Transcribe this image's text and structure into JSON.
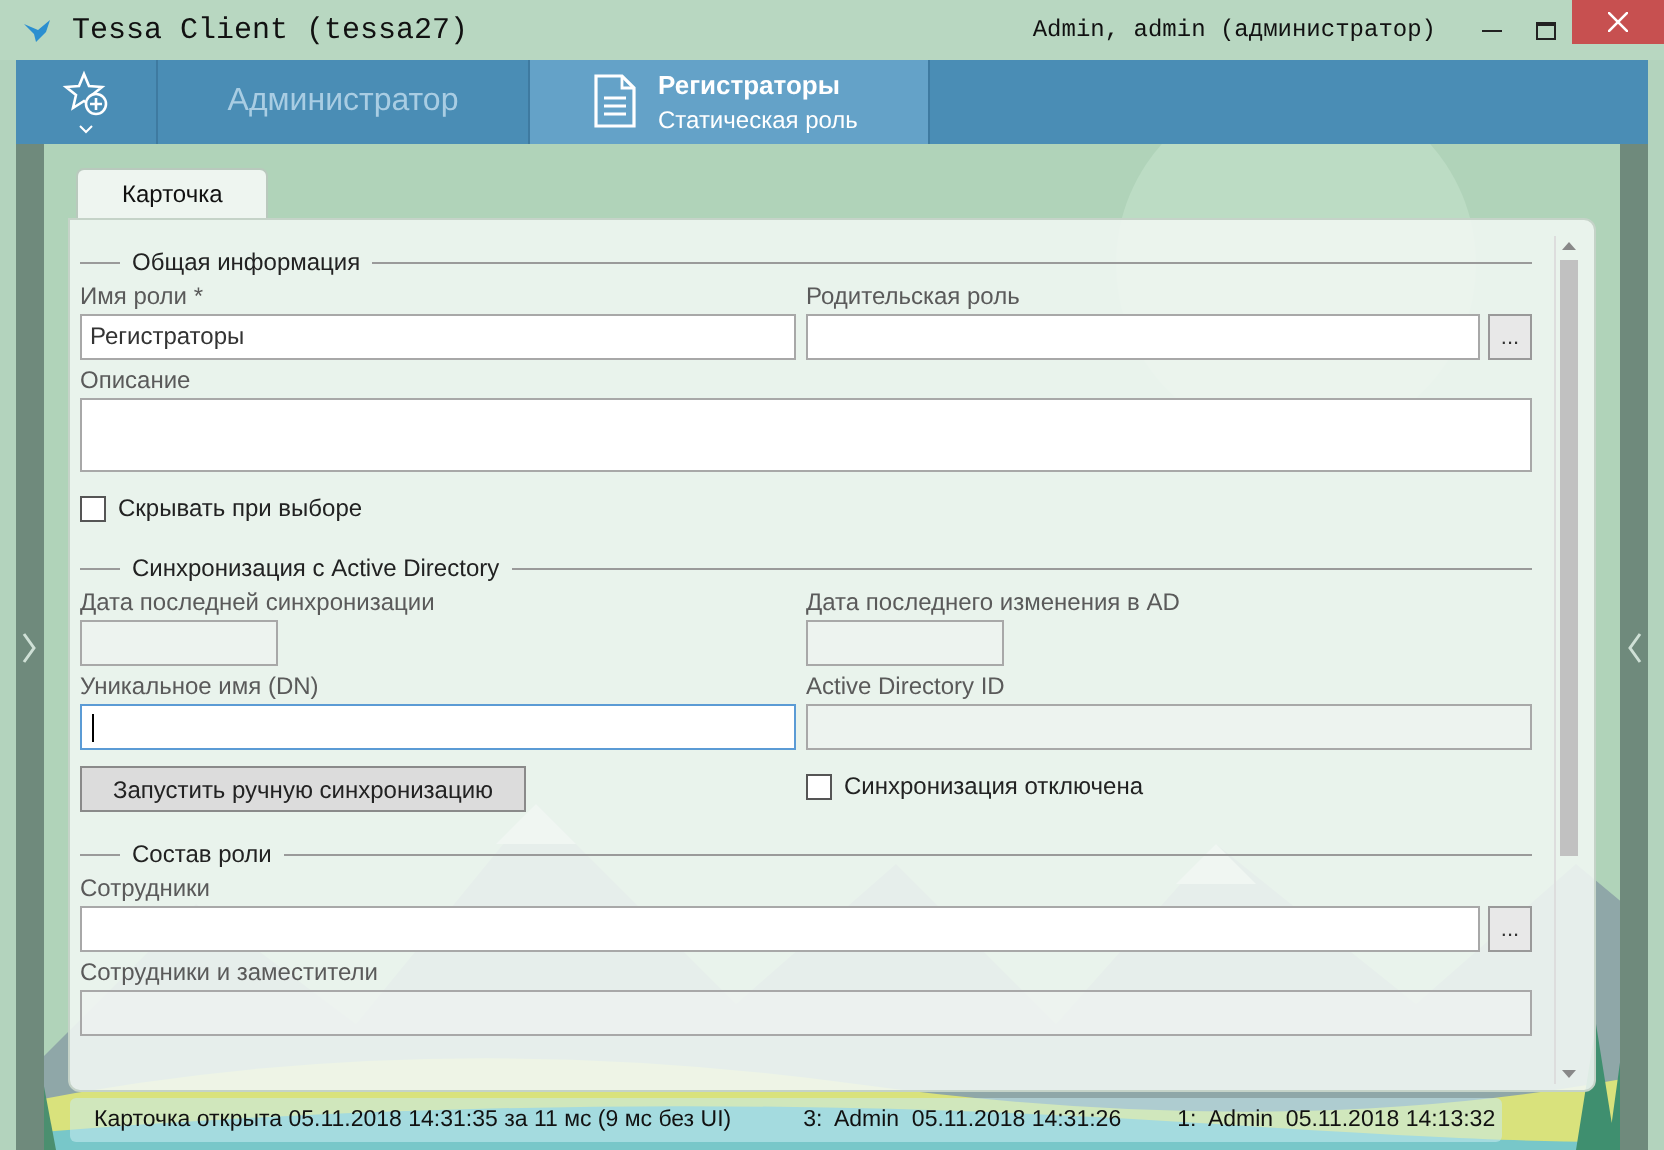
{
  "window": {
    "title": "Tessa Client (tessa27)",
    "user": "Admin, admin (администратор)"
  },
  "tabs": [
    {
      "title": "Администратор",
      "selected": false
    },
    {
      "title": "Регистраторы",
      "subtitle": "Статическая роль",
      "selected": true
    }
  ],
  "card_tabs": [
    {
      "label": "Карточка",
      "selected": true
    }
  ],
  "sections": [
    {
      "title": "Общая информация",
      "fields": [
        {
          "kind": "text",
          "label": "Имя роли  *",
          "value": "Регистраторы",
          "disabled": false,
          "focused": false
        },
        {
          "kind": "lookup",
          "label": "Родительская роль",
          "button": "...",
          "disabled": false
        },
        {
          "kind": "textarea",
          "label": "Описание",
          "wide": true
        },
        {
          "kind": "checkbox",
          "label": "Скрывать при выборе",
          "checked": false
        }
      ]
    },
    {
      "title": "Синхронизация с Active Directory",
      "fields": [
        {
          "kind": "date",
          "label": "Дата последней синхронизации",
          "disabled": true
        },
        {
          "kind": "date",
          "label": "Дата последнего изменения в AD",
          "disabled": true
        },
        {
          "kind": "text",
          "label": "Уникальное имя (DN)",
          "disabled": false,
          "focused": true
        },
        {
          "kind": "text",
          "label": "Active Directory ID",
          "disabled": true,
          "focused": false
        },
        {
          "kind": "button",
          "label": "Запустить ручную синхронизацию"
        },
        {
          "kind": "checkbox",
          "label": "Синхронизация отключена",
          "checked": false
        }
      ]
    },
    {
      "title": "Состав роли",
      "fields": [
        {
          "kind": "lookup",
          "label": "Сотрудники",
          "button": "...",
          "disabled": false,
          "wide": true
        },
        {
          "kind": "text",
          "label": "Сотрудники и заместители",
          "disabled": true,
          "focused": false,
          "wide": true
        }
      ]
    }
  ],
  "status_bar": [
    "Карточка открыта 05.11.2018 14:31:35 за 11 мс (9 мс без UI)",
    "3:  Admin  05.11.2018 14:31:26",
    "1:  Admin  05.11.2018 14:13:32"
  ]
}
